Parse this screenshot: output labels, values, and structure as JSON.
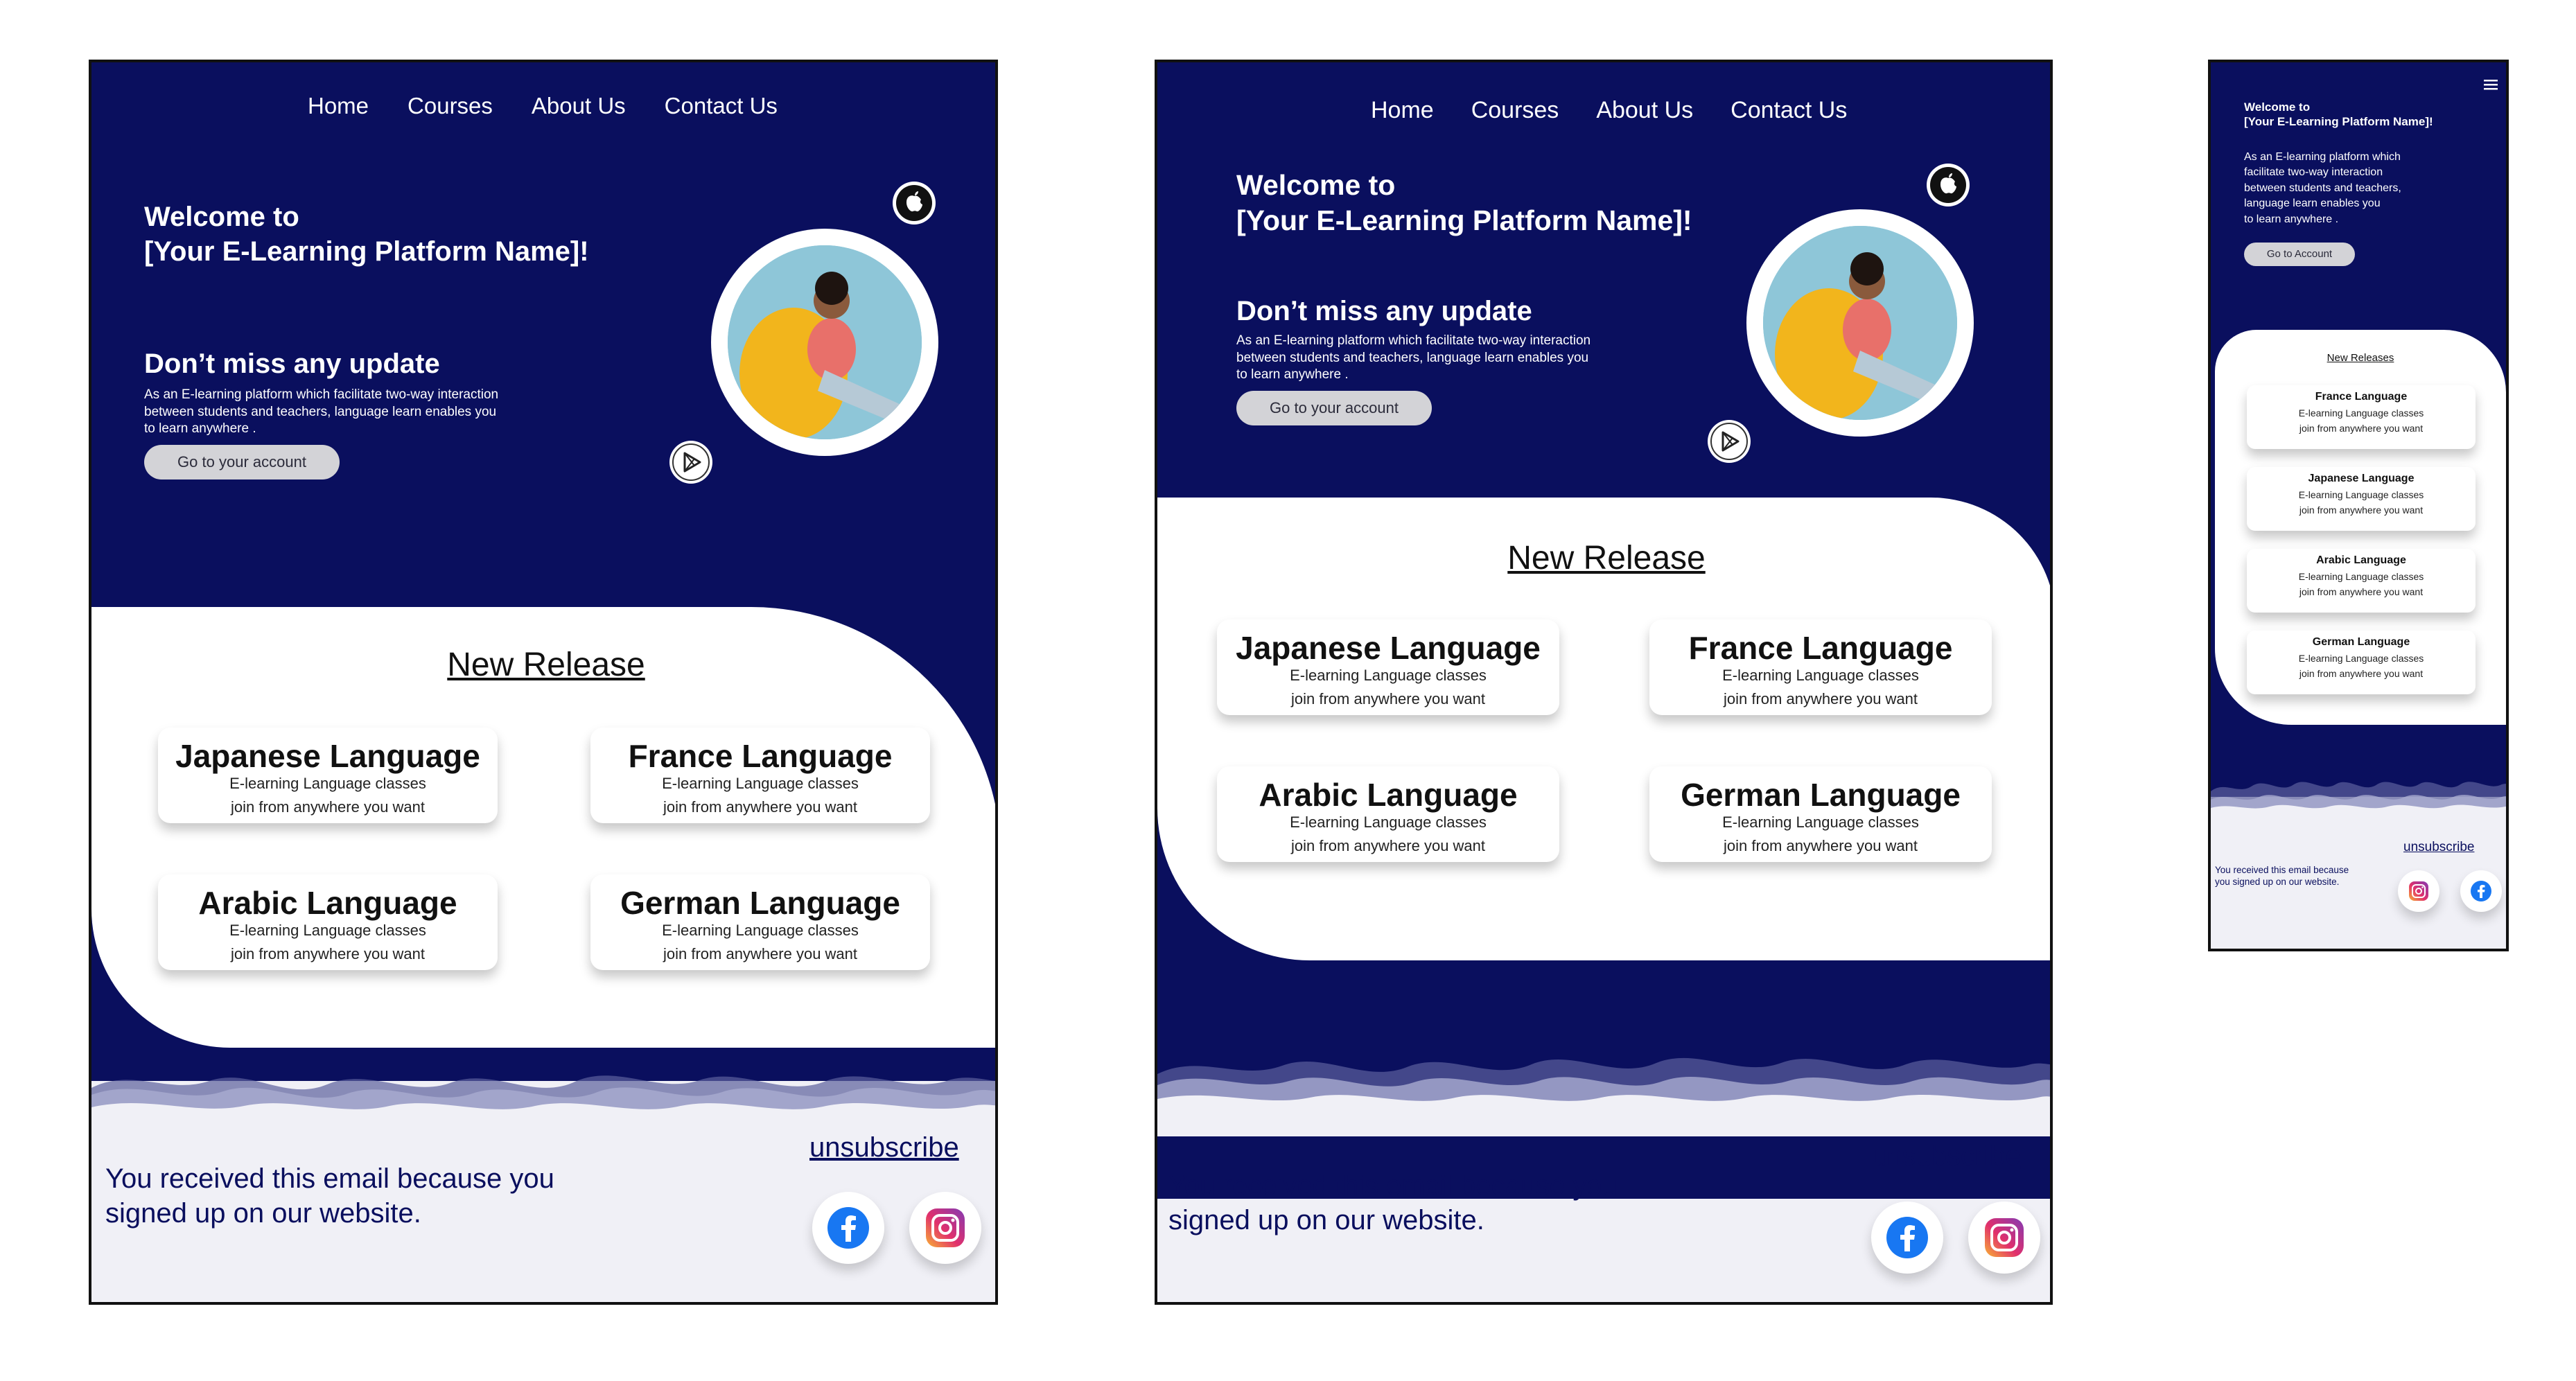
{
  "nav": {
    "items": [
      "Home",
      "Courses",
      "About Us",
      "Contact Us"
    ]
  },
  "hero": {
    "welcome_line1": "Welcome to",
    "welcome_line2": "[Your E-Learning Platform Name]!",
    "update_title": "Don’t miss any update",
    "description_line1": "As an E-learning  platform which facilitate two-way  interaction",
    "description_line2": "between students and teachers, language learn enables you",
    "description_line3": "to learn anywhere .",
    "button_label": "Go to your account"
  },
  "new_release": {
    "title": "New Release",
    "cards": [
      {
        "title": "Japanese Language",
        "line1": "E-learning Language classes",
        "line2": "join from anywhere you want"
      },
      {
        "title": "France Language",
        "line1": "E-learning Language classes",
        "line2": "join from anywhere you want"
      },
      {
        "title": "Arabic Language",
        "line1": "E-learning Language classes",
        "line2": "join from anywhere you want"
      },
      {
        "title": "German Language",
        "line1": "E-learning Language classes",
        "line2": "join from anywhere you want"
      }
    ]
  },
  "footer": {
    "notice_line1": "You received this email because you",
    "notice_line2": "signed up on our website.",
    "unsubscribe": "unsubscribe"
  },
  "mobile": {
    "welcome_line1": "Welcome to",
    "welcome_line2": "[Your E-Learning Platform Name]!",
    "description_line1": "As an E-learning  platform which",
    "description_line2": "facilitate two-way  interaction",
    "description_line3": "between students and teachers,",
    "description_line4": "language learn enables you",
    "description_line5": "to learn anywhere .",
    "button_label": "Go to Account",
    "section_title": "New Releases",
    "cards": [
      {
        "title": "France Language",
        "line1": "E-learning Language classes",
        "line2": "join from anywhere you want"
      },
      {
        "title": "Japanese Language",
        "line1": "E-learning Language classes",
        "line2": "join from anywhere you want"
      },
      {
        "title": "Arabic Language",
        "line1": "E-learning Language classes",
        "line2": "join from anywhere you want"
      },
      {
        "title": "German Language",
        "line1": "E-learning Language classes",
        "line2": "join from anywhere you want"
      }
    ],
    "unsubscribe": "unsubscribe",
    "notice_line1": "You received this email because",
    "notice_line2": "you signed up on our website."
  },
  "icons": {
    "apple": "apple-icon",
    "play_store": "play-store-icon",
    "facebook": "facebook-icon",
    "instagram": "instagram-icon",
    "menu": "hamburger-menu-icon"
  },
  "colors": {
    "navy": "#0a0f5e",
    "light_footer": "#f0f0f6",
    "button_grey": "#d3d3d7",
    "facebook_blue": "#1877f2"
  }
}
